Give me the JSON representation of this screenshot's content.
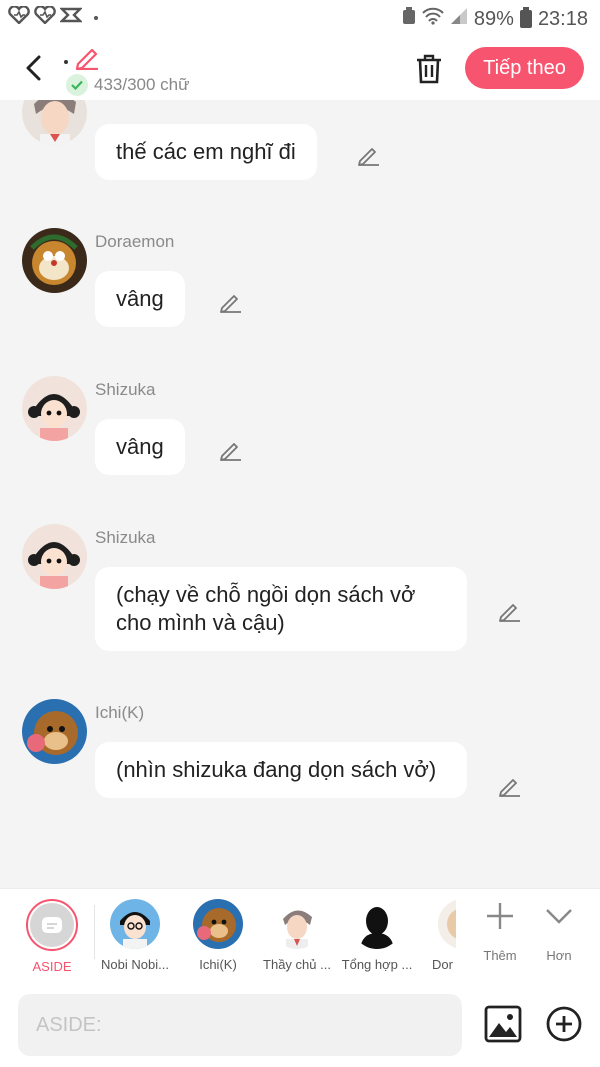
{
  "status": {
    "battery": "89%",
    "time": "23:18"
  },
  "header": {
    "word_count": "433/300 chữ",
    "next_label": "Tiếp theo"
  },
  "messages": [
    {
      "name": "",
      "text": "thế các em nghĩ đi"
    },
    {
      "name": "Doraemon",
      "text": "vâng"
    },
    {
      "name": "Shizuka",
      "text": "vâng"
    },
    {
      "name": "Shizuka",
      "text": "(chạy về chỗ ngồi dọn sách vở cho mình và cậu)"
    },
    {
      "name": "Ichi(K)",
      "text": "(nhìn shizuka đang dọn sách vở)"
    }
  ],
  "characters": [
    {
      "label": "ASIDE"
    },
    {
      "label": "Nobi Nobi..."
    },
    {
      "label": "Ichi(K)"
    },
    {
      "label": "Thầy chủ ..."
    },
    {
      "label": "Tổng hợp ..."
    },
    {
      "label": "Dor"
    }
  ],
  "tools": {
    "add_label": "Thêm",
    "more_label": "Hơn"
  },
  "input": {
    "placeholder": "ASIDE:"
  },
  "colors": {
    "accent": "#f7546f",
    "bubble": "#ffffff",
    "background": "#f4f4f4"
  }
}
